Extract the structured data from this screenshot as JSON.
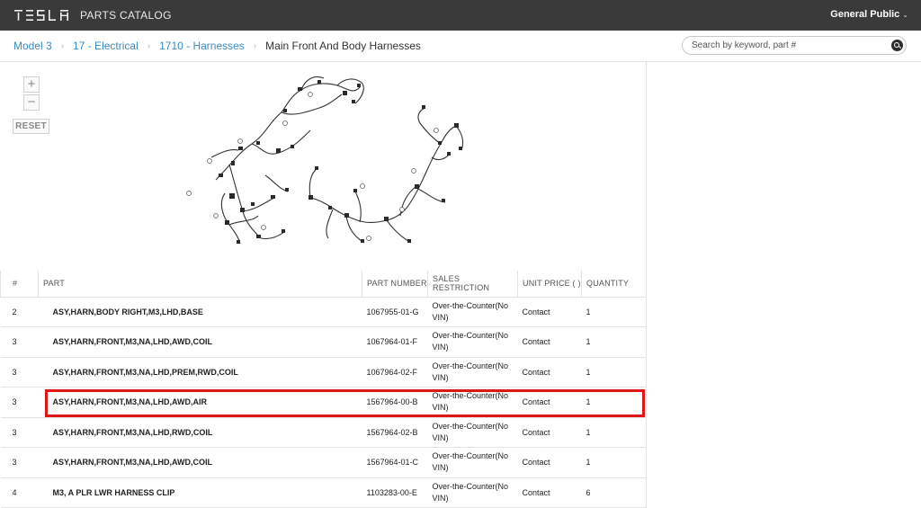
{
  "header": {
    "brand": "TESLA",
    "title": "PARTS CATALOG",
    "user": "General Public"
  },
  "breadcrumb": {
    "items": [
      "Model 3",
      "17 - Electrical",
      "1710 - Harnesses"
    ],
    "current": "Main Front And Body Harnesses"
  },
  "search": {
    "placeholder": "Search by keyword, part #"
  },
  "diagram": {
    "zoom_in": "+",
    "zoom_out": "−",
    "reset": "RESET"
  },
  "table": {
    "headers": [
      "#",
      "PART",
      "PART NUMBER",
      "SALES RESTRICTION",
      "UNIT PRICE ( )",
      "QUANTITY"
    ],
    "rows": [
      {
        "num": "2",
        "part": "ASY,HARN,BODY RIGHT,M3,LHD,BASE",
        "part_number": "1067955-01-G",
        "restriction": "Over-the-Counter(No VIN)",
        "price": "Contact",
        "qty": "1"
      },
      {
        "num": "3",
        "part": "ASY,HARN,FRONT,M3,NA,LHD,AWD,COIL",
        "part_number": "1067964-01-F",
        "restriction": "Over-the-Counter(No VIN)",
        "price": "Contact",
        "qty": "1"
      },
      {
        "num": "3",
        "part": "ASY,HARN,FRONT,M3,NA,LHD,PREM,RWD,COIL",
        "part_number": "1067964-02-F",
        "restriction": "Over-the-Counter(No VIN)",
        "price": "Contact",
        "qty": "1"
      },
      {
        "num": "3",
        "part": "ASY,HARN,FRONT,M3,NA,LHD,AWD,AIR",
        "part_number": "1567964-00-B",
        "restriction": "Over-the-Counter(No VIN)",
        "price": "Contact",
        "qty": "1"
      },
      {
        "num": "3",
        "part": "ASY,HARN,FRONT,M3,NA,LHD,RWD,COIL",
        "part_number": "1567964-02-B",
        "restriction": "Over-the-Counter(No VIN)",
        "price": "Contact",
        "qty": "1"
      },
      {
        "num": "3",
        "part": "ASY,HARN,FRONT,M3,NA,LHD,AWD,COIL",
        "part_number": "1567964-01-C",
        "restriction": "Over-the-Counter(No VIN)",
        "price": "Contact",
        "qty": "1"
      },
      {
        "num": "4",
        "part": "M3, A PLR LWR HARNESS CLIP",
        "part_number": "1103283-00-E",
        "restriction": "Over-the-Counter(No VIN)",
        "price": "Contact",
        "qty": "6"
      }
    ]
  },
  "colors": {
    "topbar": "#3a3a3a",
    "link": "#3a8cc2",
    "highlight": "#e01515"
  }
}
